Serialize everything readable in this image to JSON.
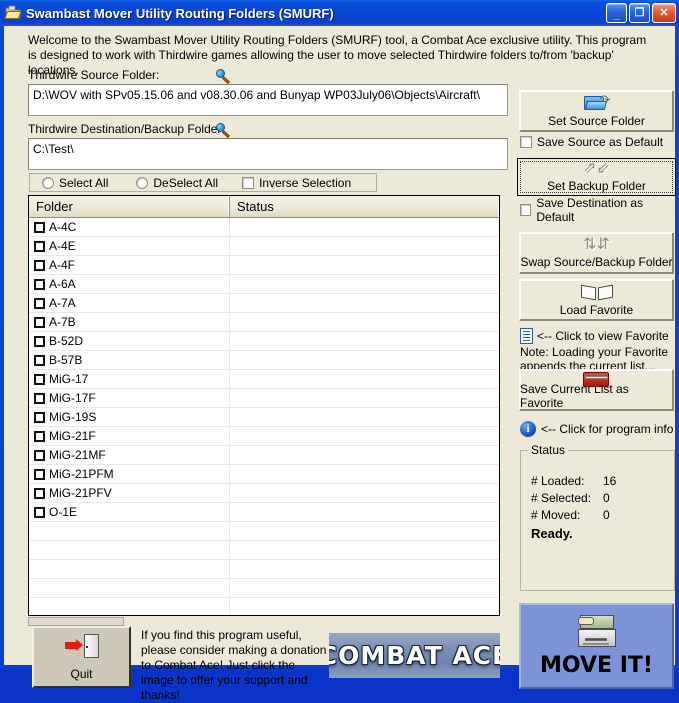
{
  "window": {
    "title": "Swambast Mover Utility Routing Folders (SMURF)",
    "icon": "folder-icon",
    "minimize_label": "_",
    "maximize_label": "❐",
    "close_label": "✕",
    "accent_color": "#0a46d2",
    "face_color": "#ECE9D8"
  },
  "intro": {
    "text": "Welcome to the Swambast Mover Utility Routing Folders (SMURF) tool, a Combat Ace exclusive utility.  This program is designed to work with Thirdwire games allowing the user to move selected Thirdwire folders to/from 'backup' locations."
  },
  "source": {
    "label": "Thirdwire Source Folder:",
    "icon": "magnifier-icon",
    "value": "D:\\WOV with SPv05.15.06 and  v08.30.06 and Bunyap WP03July06\\Objects\\Aircraft\\",
    "placeholder": ""
  },
  "destination": {
    "label": "Thirdwire Destination/Backup Folder:",
    "icon": "magnifier-icon",
    "value": "C:\\Test\\",
    "placeholder": ""
  },
  "selection_toolbar": {
    "select_all": "Select All",
    "deselect_all": "DeSelect All",
    "inverse_selection": "Inverse Selection",
    "select_all_checked": false,
    "deselect_all_checked": false,
    "inverse_checked": false
  },
  "list": {
    "columns": [
      "Folder",
      "Status"
    ],
    "rows": [
      {
        "folder": "A-4C",
        "status": "",
        "checked": false
      },
      {
        "folder": "A-4E",
        "status": "",
        "checked": false
      },
      {
        "folder": "A-4F",
        "status": "",
        "checked": false
      },
      {
        "folder": "A-6A",
        "status": "",
        "checked": false
      },
      {
        "folder": "A-7A",
        "status": "",
        "checked": false
      },
      {
        "folder": "A-7B",
        "status": "",
        "checked": false
      },
      {
        "folder": "B-52D",
        "status": "",
        "checked": false
      },
      {
        "folder": "B-57B",
        "status": "",
        "checked": false
      },
      {
        "folder": "MiG-17",
        "status": "",
        "checked": false
      },
      {
        "folder": "MiG-17F",
        "status": "",
        "checked": false
      },
      {
        "folder": "MiG-19S",
        "status": "",
        "checked": false
      },
      {
        "folder": "MiG-21F",
        "status": "",
        "checked": false
      },
      {
        "folder": "MiG-21MF",
        "status": "",
        "checked": false
      },
      {
        "folder": "MiG-21PFM",
        "status": "",
        "checked": false
      },
      {
        "folder": "MiG-21PFV",
        "status": "",
        "checked": false
      },
      {
        "folder": "O-1E",
        "status": "",
        "checked": false
      }
    ]
  },
  "right_panel": {
    "set_source_folder": "Set Source Folder",
    "set_source_icon": "open-folder-icon",
    "save_source_default": "Save Source as Default",
    "save_source_default_checked": false,
    "set_backup_folder": "Set Backup Folder",
    "set_backup_icon": "swap-arrows-icon",
    "set_backup_focused": true,
    "save_destination_default": "Save Destination as Default",
    "save_destination_default_checked": false,
    "swap_folders": "Swap Source/Backup Folder",
    "swap_icon": "double-swap-arrows-icon",
    "load_favorite": "Load Favorite",
    "load_favorite_icon": "open-book-icon",
    "view_favorite": "<-- Click to view Favorite",
    "view_favorite_icon": "document-icon",
    "favorite_note": "Note: Loading your Favorite appends the current list...",
    "save_favorite": "Save Current List as Favorite",
    "save_favorite_icon": "red-book-icon",
    "program_info": "<-- Click for program info",
    "program_info_icon": "info-icon"
  },
  "status": {
    "legend": "Status",
    "loaded_label": "# Loaded:",
    "loaded_value": "16",
    "selected_label": "# Selected:",
    "selected_value": "0",
    "moved_label": "# Moved:",
    "moved_value": "0",
    "message": "Ready."
  },
  "footer": {
    "quit_label": "Quit",
    "quit_icon": "exit-door-icon",
    "donate_text": "If you find this program useful, please consider making a donation to Combat Ace!  Just click the image to offer your support and thanks!",
    "banner_text": "COMBAT ACE",
    "move_label": "MOVE IT!",
    "move_icon": "file-box-icon"
  }
}
